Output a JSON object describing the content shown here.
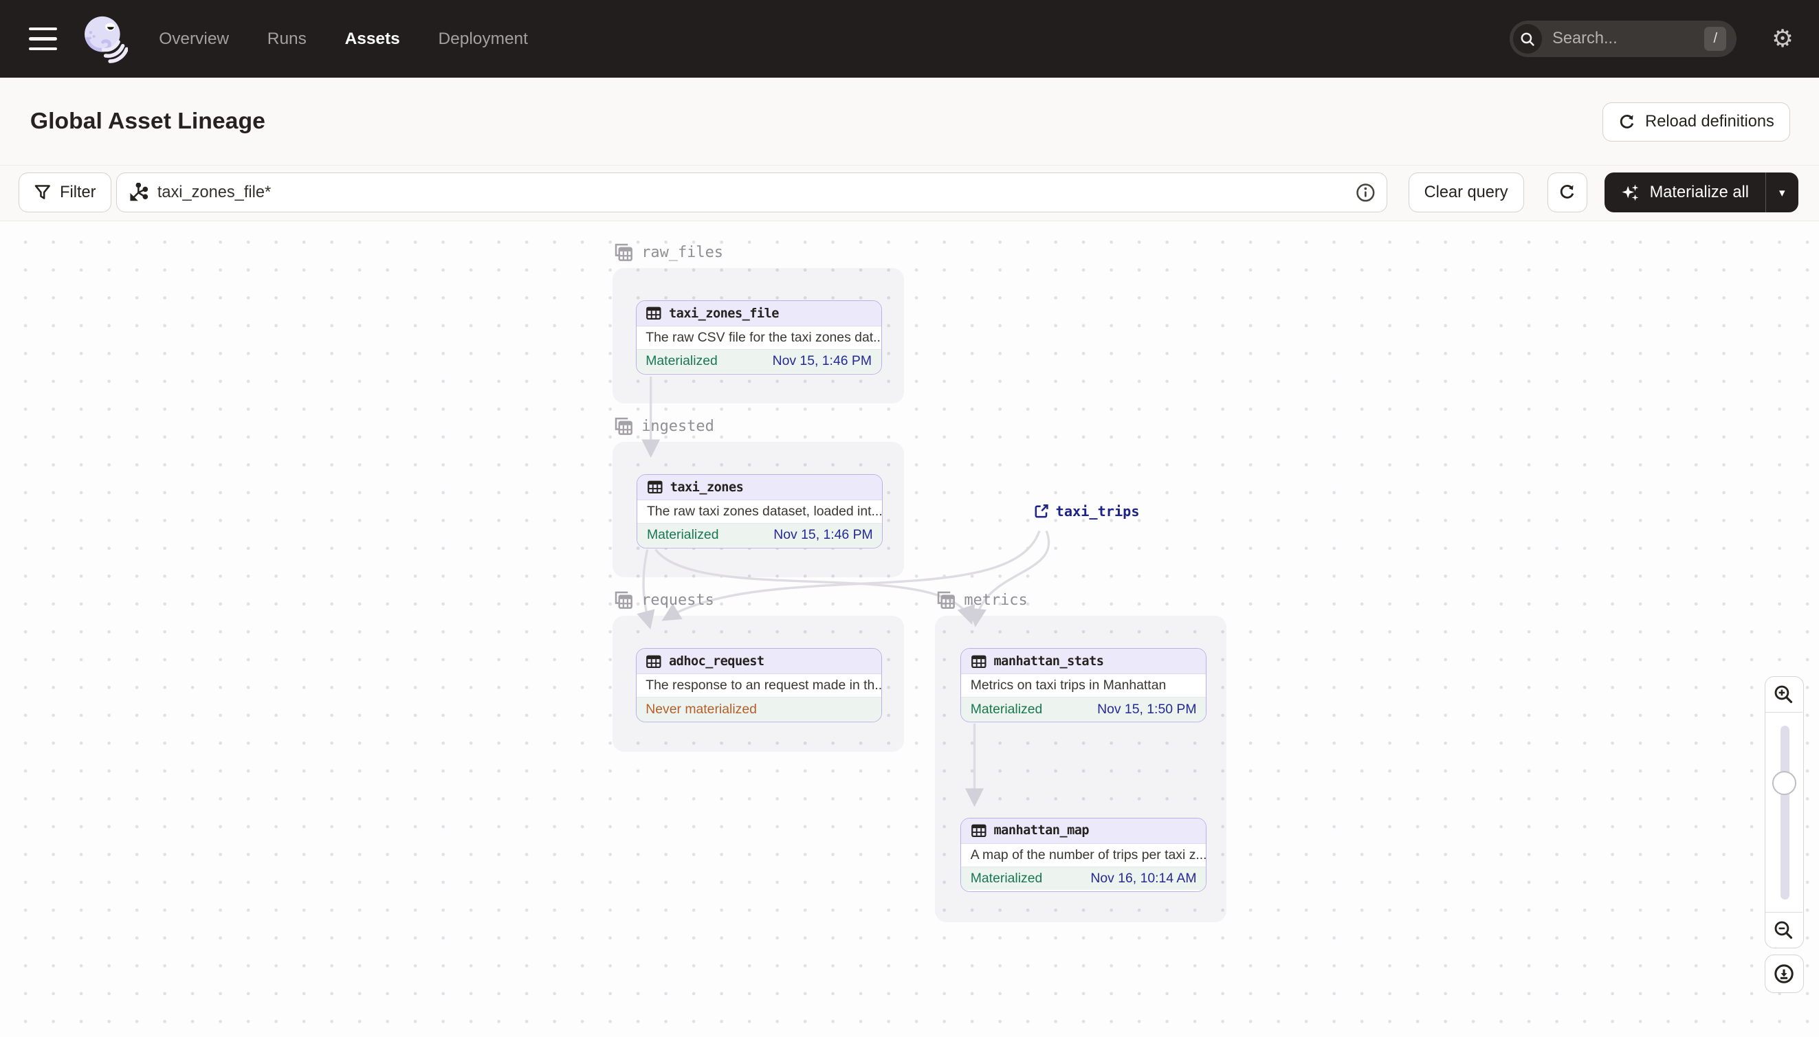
{
  "nav": {
    "items": [
      {
        "label": "Overview",
        "active": false
      },
      {
        "label": "Runs",
        "active": false
      },
      {
        "label": "Assets",
        "active": true
      },
      {
        "label": "Deployment",
        "active": false
      }
    ],
    "search": {
      "placeholder": "Search...",
      "shortcut": "/"
    }
  },
  "header": {
    "title": "Global Asset Lineage",
    "reload_label": "Reload definitions"
  },
  "toolbar": {
    "filter_label": "Filter",
    "query_value": "taxi_zones_file*",
    "clear_label": "Clear query",
    "materialize_label": "Materialize all"
  },
  "graph": {
    "groups": [
      {
        "name": "raw_files"
      },
      {
        "name": "ingested"
      },
      {
        "name": "requests"
      },
      {
        "name": "metrics"
      }
    ],
    "nodes": [
      {
        "name": "taxi_zones_file",
        "group": "raw_files",
        "description": "The raw CSV file for the taxi zones dat...",
        "status": "Materialized",
        "timestamp": "Nov 15, 1:46 PM"
      },
      {
        "name": "taxi_zones",
        "group": "ingested",
        "description": "The raw taxi zones dataset, loaded int...",
        "status": "Materialized",
        "timestamp": "Nov 15, 1:46 PM"
      },
      {
        "name": "adhoc_request",
        "group": "requests",
        "description": "The response to an request made in th...",
        "status": "Never materialized",
        "timestamp": ""
      },
      {
        "name": "manhattan_stats",
        "group": "metrics",
        "description": "Metrics on taxi trips in Manhattan",
        "status": "Materialized",
        "timestamp": "Nov 15, 1:50 PM"
      },
      {
        "name": "manhattan_map",
        "group": "metrics",
        "description": "A map of the number of trips per taxi z...",
        "status": "Materialized",
        "timestamp": "Nov 16, 10:14 AM"
      }
    ],
    "external": {
      "name": "taxi_trips"
    },
    "edges": [
      [
        "taxi_zones_file",
        "taxi_zones"
      ],
      [
        "taxi_zones",
        "adhoc_request"
      ],
      [
        "taxi_zones",
        "manhattan_stats"
      ],
      [
        "taxi_trips",
        "adhoc_request"
      ],
      [
        "taxi_trips",
        "manhattan_stats"
      ],
      [
        "manhattan_stats",
        "manhattan_map"
      ]
    ],
    "colors": {
      "node_border": "#B6B2E9",
      "node_header_bg": "#ECEAFA",
      "materialized_green": "#18784F",
      "never_materialized_orange": "#B35F2B",
      "timestamp_navy": "#232A96",
      "external_asset_navy": "#1D2487",
      "edge_gray": "#DEDCE2",
      "nav_bg": "#211E1D",
      "dark_button_bg": "#231F1E"
    }
  }
}
